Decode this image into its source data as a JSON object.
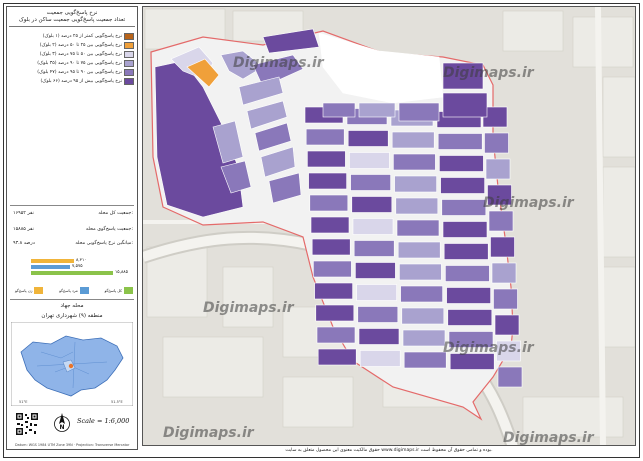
{
  "header": {
    "title": "نرخ پاسخ‌گویی جمعیت",
    "subtitle": "تعداد جمعیت پاسخ‌گویی جمعیت ساکن در بلوک"
  },
  "legend": {
    "items": [
      {
        "label": "نرخ پاسخ‌گویی کمتر از ۲۵ درصد (۱ بلوک)",
        "color": "#b8641a"
      },
      {
        "label": "نرخ پاسخ‌گویی بین ۲۵ تا ۵۰ درصد (۲ بلوک)",
        "color": "#f0a03a"
      },
      {
        "label": "نرخ پاسخ‌گویی بین ۵۰ تا ۷۵ درصد (۳ بلوک)",
        "color": "#d9d6ea"
      },
      {
        "label": "نرخ پاسخ‌گویی بین ۷۵ تا ۹۰ درصد (۳۵ بلوک)",
        "color": "#a9a2cf"
      },
      {
        "label": "نرخ پاسخ‌گویی بین ۹۰ تا ۹۵ درصد (۴۷ بلوک)",
        "color": "#8a78ba"
      },
      {
        "label": "نرخ پاسخ‌گویی بیش از ۹۵ درصد (۶۶ بلوک)",
        "color": "#6b4a9e"
      }
    ]
  },
  "stats": {
    "total_population_label": "جمعیت کل محله:",
    "total_population_value": "۱۶۹۵۲ نفر",
    "respondents_label": "جمعیت پاسخ‌گوی محله:",
    "respondents_value": "۱۵۸۸۵ نفر",
    "rate_label": "میانگین نرخ پاسخ‌گویی محله:",
    "rate_value": "۹۳.۸ درصد"
  },
  "bars": {
    "values": [
      {
        "name": "زن پاسخ‌گو",
        "value": 8310,
        "text": "۸,۳۱۰",
        "color": "#f0b43a"
      },
      {
        "name": "مرد پاسخ‌گو",
        "value": 7575,
        "text": "۷,۵۷۵",
        "color": "#5b9bd5"
      },
      {
        "name": "کل پاسخ‌گو",
        "value": 15885,
        "text": "۱۵,۸۸۵",
        "color": "#8bc34a"
      }
    ],
    "max": 15885
  },
  "location": {
    "title": "محله جهاد",
    "subtitle": "منطقه (۹) شهرداری تهران"
  },
  "scale": "Scale = 1:6,000",
  "north_label": "N",
  "footer_left": "Datum: WGS 1984 UTM Zone 39N · Projection: Transverse Mercator",
  "footer": "حقوق مالکیت معنوی این محصول متعلق به سایت www.digimaps.ir بوده و تمامی حقوق آن محفوظ است.",
  "watermark": "Digimaps.ir"
}
